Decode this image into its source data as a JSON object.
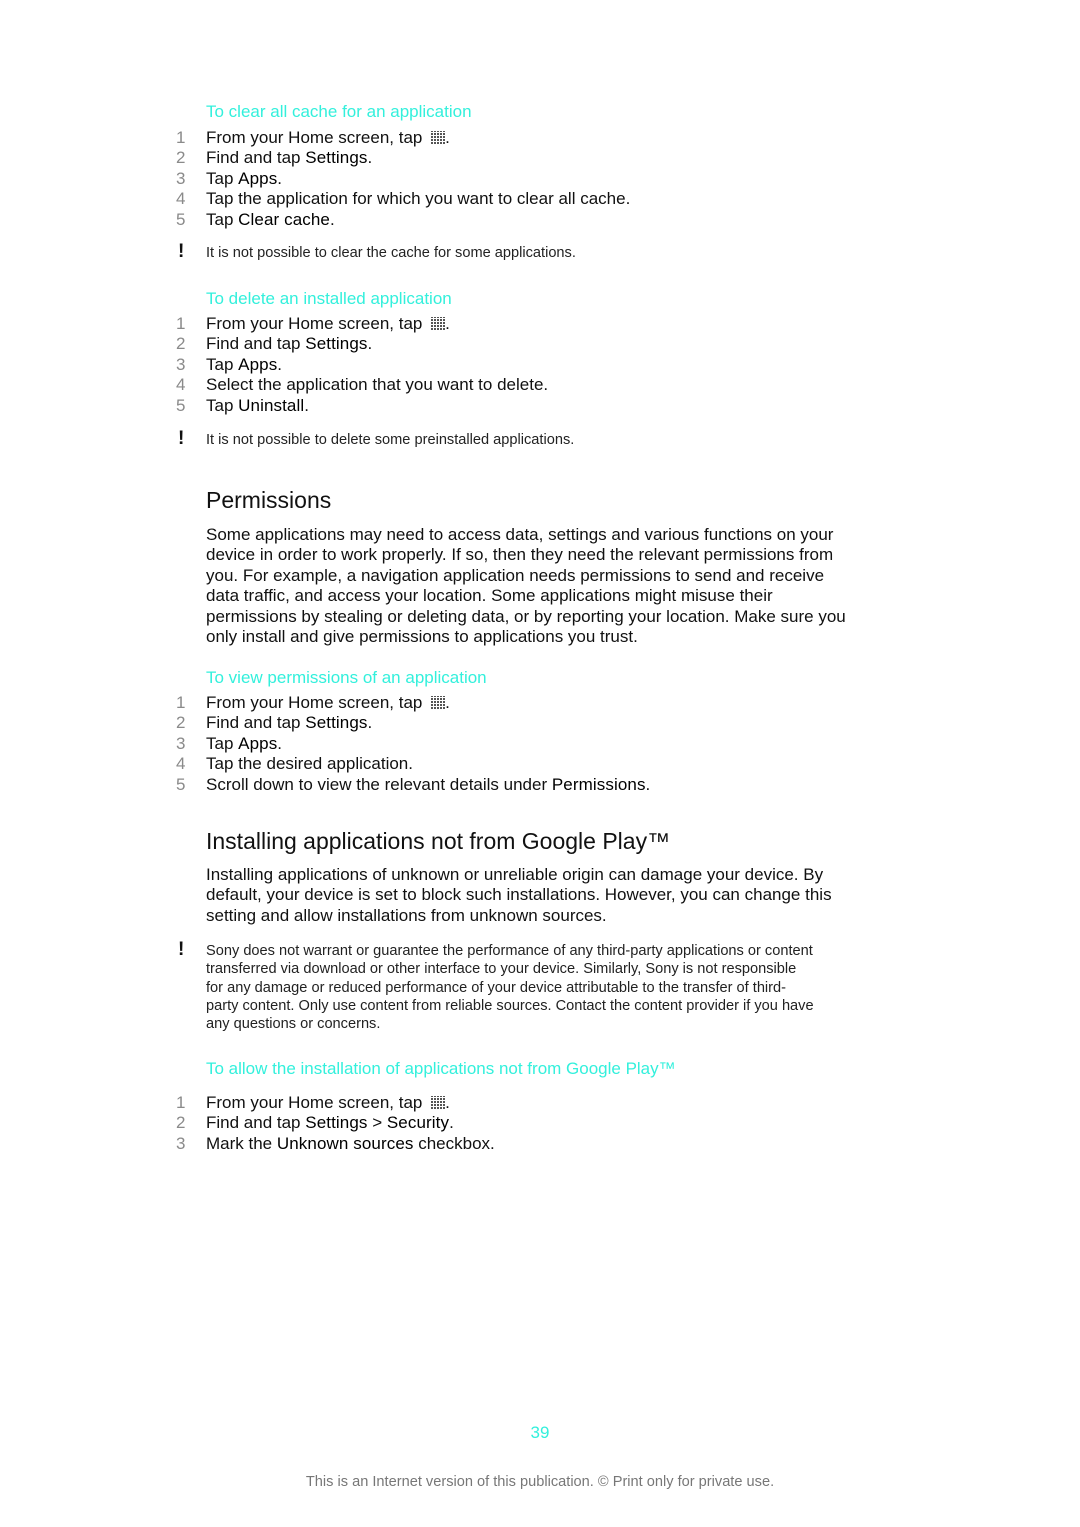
{
  "colors": {
    "accent": "#33f0dc",
    "text": "#111111",
    "step_number": "#8a8a8a",
    "footer": "#777777"
  },
  "sections": {
    "clear_cache": {
      "title": "To clear all cache for an application",
      "steps": [
        {
          "num": "1",
          "pre": "From your Home screen, tap ",
          "icon": "apps-grid-icon",
          "post": "."
        },
        {
          "num": "2",
          "pre": "Find and tap ",
          "bold": "Settings",
          "post": "."
        },
        {
          "num": "3",
          "pre": "Tap ",
          "bold": "Apps",
          "post": "."
        },
        {
          "num": "4",
          "pre": "Tap the application for which you want to clear all cache."
        },
        {
          "num": "5",
          "pre": "Tap ",
          "bold": "Clear cache",
          "post": "."
        }
      ],
      "note_icon": "!",
      "note": "It is not possible to clear the cache for some applications."
    },
    "delete_app": {
      "title": "To delete an installed application",
      "steps": [
        {
          "num": "1",
          "pre": "From your Home screen, tap ",
          "icon": "apps-grid-icon",
          "post": "."
        },
        {
          "num": "2",
          "pre": "Find and tap ",
          "bold": "Settings",
          "post": "."
        },
        {
          "num": "3",
          "pre": "Tap ",
          "bold": "Apps",
          "post": "."
        },
        {
          "num": "4",
          "pre": "Select the application that you want to delete."
        },
        {
          "num": "5",
          "pre": "Tap ",
          "bold": "Uninstall",
          "post": "."
        }
      ],
      "note_icon": "!",
      "note": "It is not possible to delete some preinstalled applications."
    },
    "permissions": {
      "heading": "Permissions",
      "paragraph_lines": [
        "Some applications may need to access data, settings and various functions on your",
        "device in order to work properly. If so, then they need the relevant permissions from",
        "you. For example, a navigation application needs permissions to send and receive",
        "data traffic, and access your location. Some applications might misuse their",
        "permissions by stealing or deleting data, or by reporting your location. Make sure you",
        "only install and give permissions to applications you trust."
      ]
    },
    "view_permissions": {
      "title": "To view permissions of an application",
      "steps": [
        {
          "num": "1",
          "pre": "From your Home screen, tap ",
          "icon": "apps-grid-icon",
          "post": "."
        },
        {
          "num": "2",
          "pre": "Find and tap ",
          "bold": "Settings",
          "post": "."
        },
        {
          "num": "3",
          "pre": "Tap ",
          "bold": "Apps",
          "post": "."
        },
        {
          "num": "4",
          "pre": "Tap the desired application."
        },
        {
          "num": "5",
          "pre": "Scroll down to view the relevant details under ",
          "bold": "Permissions",
          "post": "."
        }
      ]
    },
    "not_google_play": {
      "heading": "Installing applications not from Google Play™",
      "paragraph_lines": [
        "Installing applications of unknown or unreliable origin can damage your device. By",
        "default, your device is set to block such installations. However, you can change this",
        "setting and allow installations from unknown sources."
      ],
      "note_icon": "!",
      "note_lines": [
        "Sony does not warrant or guarantee the performance of any third-party applications or content",
        "transferred via download or other interface to your device. Similarly, Sony is not responsible",
        "for any damage or reduced performance of your device attributable to the transfer of third-",
        "party content. Only use content from reliable sources. Contact the content provider if you have",
        "any questions or concerns."
      ]
    },
    "allow_install": {
      "title": "To allow the installation of applications not from Google Play™",
      "steps": [
        {
          "num": "1",
          "pre": "From your Home screen, tap ",
          "icon": "apps-grid-icon",
          "post": "."
        },
        {
          "num": "2",
          "pre": "Find and tap ",
          "bold": "Settings",
          "mid": " > ",
          "bold2": "Security",
          "post": "."
        },
        {
          "num": "3",
          "pre": "Mark the ",
          "bold": "Unknown sources",
          "post": " checkbox."
        }
      ]
    }
  },
  "page_number": "39",
  "footer": "This is an Internet version of this publication. © Print only for private use."
}
